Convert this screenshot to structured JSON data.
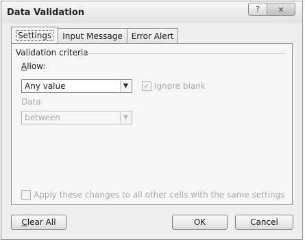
{
  "window": {
    "title": "Data Validation",
    "help_glyph": "?",
    "close_glyph": "x"
  },
  "tabs": [
    {
      "label": "Settings",
      "active": true
    },
    {
      "label": "Input Message",
      "active": false
    },
    {
      "label": "Error Alert",
      "active": false
    }
  ],
  "settings": {
    "group_label": "Validation criteria",
    "allow": {
      "label_accel": "A",
      "label_rest": "llow:",
      "value": "Any value",
      "icon": "chevron-down-icon"
    },
    "ignore_blank": {
      "label": "Ignore blank",
      "checked": true,
      "enabled": false
    },
    "data": {
      "label": "Data:",
      "value": "between",
      "enabled": false
    },
    "apply_all": {
      "label": "Apply these changes to all other cells with the same settings",
      "checked": false,
      "enabled": false
    }
  },
  "buttons": {
    "clear_all": {
      "accel": "C",
      "rest": "lear All"
    },
    "ok": "OK",
    "cancel": "Cancel"
  }
}
